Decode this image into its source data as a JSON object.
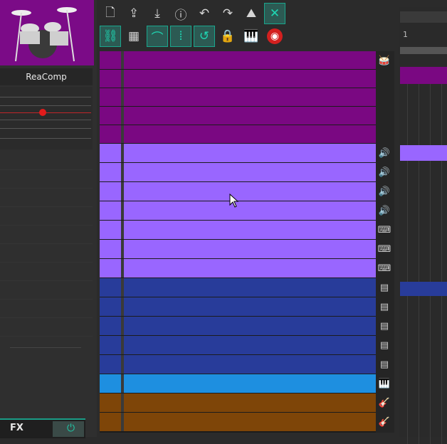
{
  "fx_panel": {
    "plugin_name": "ReaComp",
    "fx_button": "FX"
  },
  "toolbar": {
    "row1": [
      {
        "icon": "new-file-icon",
        "glyph": "🗋",
        "active": false
      },
      {
        "icon": "upload-icon",
        "glyph": "⇪",
        "active": false
      },
      {
        "icon": "download-icon",
        "glyph": "⤓",
        "active": false
      },
      {
        "icon": "info-icon",
        "glyph": "ⓘ",
        "active": false
      },
      {
        "icon": "undo-icon",
        "glyph": "↶",
        "active": false
      },
      {
        "icon": "redo-icon",
        "glyph": "↷",
        "active": false
      },
      {
        "icon": "metronome-icon",
        "glyph": "⛰",
        "active": false
      },
      {
        "icon": "crossfade-icon",
        "glyph": "✕",
        "active": true
      }
    ],
    "row2": [
      {
        "icon": "link-icon",
        "glyph": "⛓",
        "active": true
      },
      {
        "icon": "grid-icon",
        "glyph": "▦",
        "active": false
      },
      {
        "icon": "ripple-edit-icon",
        "glyph": "⌒",
        "active": true
      },
      {
        "icon": "snap-grid-icon",
        "glyph": "⦙",
        "active": true
      },
      {
        "icon": "loop-icon",
        "glyph": "↺",
        "active": true
      },
      {
        "icon": "lock-icon",
        "glyph": "🔒",
        "active": false
      },
      {
        "icon": "piano-icon",
        "glyph": "🎹",
        "active": false
      },
      {
        "icon": "record-icon",
        "glyph": "◉",
        "active": false
      }
    ]
  },
  "tracks": [
    {
      "color": "#7a0882",
      "icon": "drum-icon"
    },
    {
      "color": "#7a0882",
      "icon": ""
    },
    {
      "color": "#7a0882",
      "icon": ""
    },
    {
      "color": "#7a0882",
      "icon": ""
    },
    {
      "color": "#7a0882",
      "icon": ""
    },
    {
      "color": "#9966ff",
      "icon": "speaker-icon"
    },
    {
      "color": "#9966ff",
      "icon": "speaker-icon"
    },
    {
      "color": "#9966ff",
      "icon": "speaker-icon"
    },
    {
      "color": "#9966ff",
      "icon": "speaker-icon"
    },
    {
      "color": "#9966ff",
      "icon": "keyboard-icon"
    },
    {
      "color": "#9966ff",
      "icon": "keyboard-icon"
    },
    {
      "color": "#9966ff",
      "icon": "keyboard-icon"
    },
    {
      "color": "#283c9a",
      "icon": "synth-icon"
    },
    {
      "color": "#283c9a",
      "icon": "synth-icon"
    },
    {
      "color": "#283c9a",
      "icon": "synth-icon"
    },
    {
      "color": "#283c9a",
      "icon": "synth-icon"
    },
    {
      "color": "#283c9a",
      "icon": "synth-icon"
    },
    {
      "color": "#1e8fe0",
      "icon": "piano-track-icon"
    },
    {
      "color": "#7e4508",
      "icon": "guitar-icon"
    },
    {
      "color": "#7e4508",
      "icon": "guitar-icon"
    }
  ],
  "arrange": {
    "bar_number": "1"
  }
}
